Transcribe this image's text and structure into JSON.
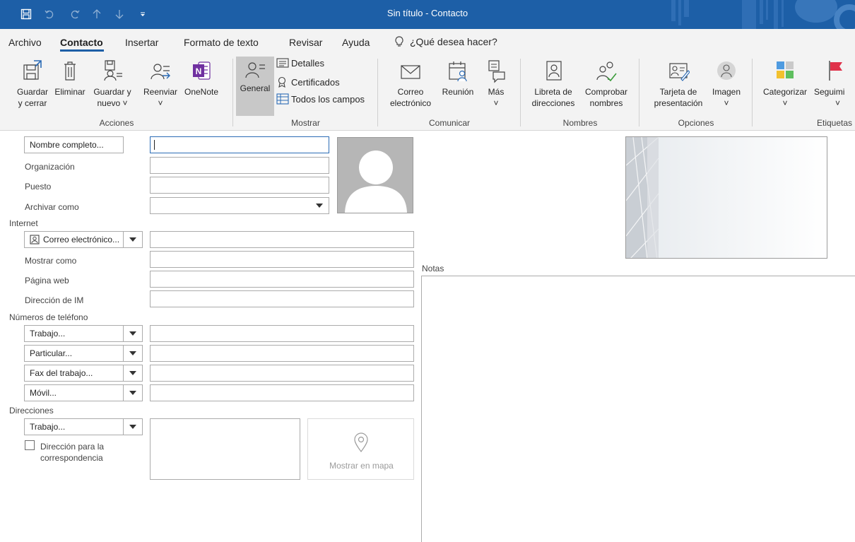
{
  "window": {
    "title": "Sin título - Contacto"
  },
  "quick_access": {
    "save_icon": "save-icon",
    "undo_icon": "undo-icon",
    "redo_icon": "redo-icon",
    "up_icon": "arrow-up-icon",
    "down_icon": "arrow-down-icon",
    "customize_icon": "customize-qat-icon"
  },
  "tabs": [
    {
      "label": "Archivo"
    },
    {
      "label": "Contacto"
    },
    {
      "label": "Insertar"
    },
    {
      "label": "Formato de texto"
    },
    {
      "label": "Revisar"
    },
    {
      "label": "Ayuda"
    }
  ],
  "tell_me": {
    "label": "¿Qué desea hacer?"
  },
  "ribbon": {
    "acciones": {
      "label": "Acciones",
      "save_close": [
        "Guardar",
        "y cerrar"
      ],
      "delete": "Eliminar",
      "save_new": [
        "Guardar y",
        "nuevo"
      ],
      "forward": "Reenviar",
      "onenote": "OneNote"
    },
    "mostrar": {
      "label": "Mostrar",
      "general": "General",
      "details": "Detalles",
      "certificates": "Certificados",
      "all_fields": "Todos los campos"
    },
    "comunicar": {
      "label": "Comunicar",
      "email": [
        "Correo",
        "electrónico"
      ],
      "meeting": "Reunión",
      "more": "Más"
    },
    "nombres": {
      "label": "Nombres",
      "address_book": [
        "Libreta de",
        "direcciones"
      ],
      "check_names": [
        "Comprobar",
        "nombres"
      ]
    },
    "opciones": {
      "label": "Opciones",
      "business_card": [
        "Tarjeta de",
        "presentación"
      ],
      "picture": "Imagen"
    },
    "etiquetas": {
      "label": "Etiquetas",
      "categorize": "Categorizar",
      "follow_up": "Seguimi"
    }
  },
  "form": {
    "full_name_button": "Nombre completo...",
    "company": "Organización",
    "job_title": "Puesto",
    "file_as": "Archivar como",
    "internet_section": "Internet",
    "email_button": "Correo electrónico...",
    "display_as": "Mostrar como",
    "web_page": "Página web",
    "im_address": "Dirección de IM",
    "phones_section": "Números de teléfono",
    "phone_business": "Trabajo...",
    "phone_home": "Particular...",
    "phone_business_fax": "Fax del trabajo...",
    "phone_mobile": "Móvil...",
    "addresses_section": "Direcciones",
    "address_type": "Trabajo...",
    "mailing_address": [
      "Dirección para la",
      "correspondencia"
    ],
    "show_map": "Mostrar en mapa",
    "notes": "Notas"
  },
  "colors": {
    "titlebar": "#1d5fa7",
    "ribbon_bg": "#f3f3f3",
    "onenote_purple": "#7030a0",
    "selected_bg": "#c8c8c8"
  }
}
